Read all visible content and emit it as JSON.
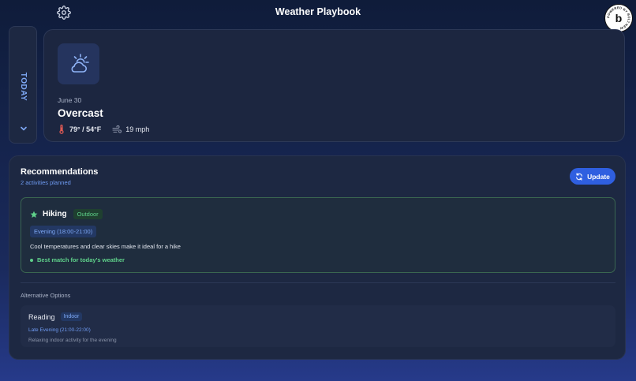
{
  "header": {
    "title": "Weather Playbook",
    "settings_icon": "gear-icon",
    "badge": {
      "text": "POWERED BY BOLT.NEW",
      "letter": "b"
    }
  },
  "today_tab": {
    "label": "TODAY",
    "icon": "chevron-down-icon"
  },
  "weather": {
    "icon": "sun-cloud-icon",
    "date": "June 30",
    "condition": "Overcast",
    "temperature": "79° / 54°F",
    "wind": "19 mph",
    "temp_icon": "thermometer-icon",
    "wind_icon": "wind-icon"
  },
  "recommendations": {
    "title": "Recommendations",
    "subtitle": "2 activities planned",
    "update_label": "Update",
    "best": {
      "name": "Hiking",
      "tag": "Outdoor",
      "time": "Evening (18:00-21:00)",
      "description": "Cool temperatures and clear skies make it ideal for a hike",
      "match": "Best match for today's weather"
    },
    "alternatives_heading": "Alternative Options",
    "alternatives": [
      {
        "name": "Reading",
        "tag": "Indoor",
        "time": "Late Evening (21:00-22:00)",
        "description": "Relaxing indoor activity for the evening"
      }
    ]
  },
  "colors": {
    "accent": "#2f5fe0",
    "accent_text": "#7ea8f5",
    "success": "#5fd18a",
    "temp_icon": "#e05a55"
  }
}
